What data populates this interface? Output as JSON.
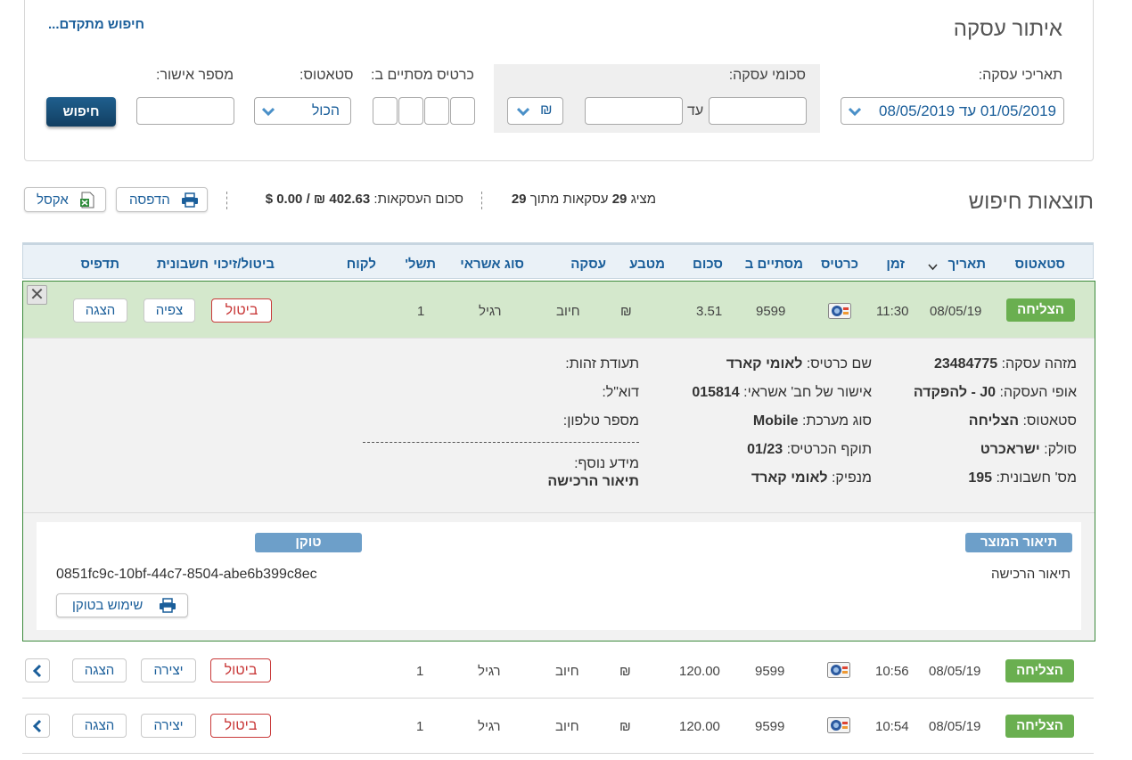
{
  "search": {
    "title": "איתור עסקה",
    "advanced_link": "חיפוש מתקדם...",
    "dates_label": "תאריכי עסקה:",
    "dates_value": "01/05/2019 עד 08/05/2019",
    "sums_label": "סכומי עסקה:",
    "sums_to": "עד",
    "currency_selected": "₪",
    "card_last_label": "כרטיס מסתיים ב:",
    "status_label": "סטאטוס:",
    "status_selected": "הכול",
    "approval_label": "מספר אישור:",
    "search_button": "חיפוש"
  },
  "results": {
    "title": "תוצאות חיפוש",
    "showing_prefix": "מציג",
    "showing_count": "29",
    "showing_mid": "עסקאות מתוך",
    "showing_total": "29",
    "sum_label": "סכום העסקאות:",
    "sum_ils": "402.63",
    "ils_sign": "₪",
    "slash": "/",
    "sum_usd": "0.00",
    "usd_sign": "$",
    "print_button": "הדפסה",
    "excel_button": "אקסל"
  },
  "columns": {
    "status": "סטאטוס",
    "date": "תאריך",
    "time": "זמן",
    "card": "כרטיס",
    "ends_with": "מסתיים ב",
    "amount": "סכום",
    "currency": "מטבע",
    "transaction": "עסקה",
    "credit_type": "סוג אשראי",
    "payments": "תשל'",
    "customer": "לקוח",
    "cancel_credit": "ביטול/זיכוי",
    "invoice": "חשבונית",
    "print": "תדפיס"
  },
  "expanded_row": {
    "status": "הצליחה",
    "date": "08/05/19",
    "time": "11:30",
    "ends_with": "9599",
    "amount": "3.51",
    "currency": "₪",
    "transaction": "חיוב",
    "credit_type": "רגיל",
    "payments": "1",
    "cancel_button": "ביטול",
    "invoice_button": "צפיה",
    "print_button": "הצגה",
    "close": "✕",
    "details": {
      "txn_id_label": "מזהה עסקה:",
      "txn_id": "23484775",
      "txn_mode_label": "אופי העסקה:",
      "txn_mode": "J0 - להפקדה",
      "status_label": "סטאטוס:",
      "status": "הצליחה",
      "acquirer_label": "סולק:",
      "acquirer": "ישראכרט",
      "invoice_no_label": "מס' חשבונית:",
      "invoice_no": "195",
      "card_name_label": "שם כרטיס:",
      "card_name": "לאומי קארד",
      "approval_label": "אישור של חב' אשראי:",
      "approval": "015814",
      "system_type_label": "סוג מערכת:",
      "system_type": "Mobile",
      "expiry_label": "תוקף הכרטיס:",
      "expiry": "01/23",
      "issuer_label": "מנפיק:",
      "issuer": "לאומי קארד",
      "id_label": "תעודת זהות:",
      "email_label": "דוא\"ל:",
      "phone_label": "מספר טלפון:",
      "extra_label": "מידע נוסף:",
      "extra_value": "תיאור הרכישה"
    },
    "product_tag": "תיאור המוצר",
    "product_desc": "תיאור הרכישה",
    "token_tag": "טוקן",
    "token_value": "0851fc9c-10bf-44c7-8504-abe6b399c8ec",
    "use_token_button": "שימוש בטוקן"
  },
  "rows": [
    {
      "status": "הצליחה",
      "date": "08/05/19",
      "time": "10:56",
      "ends_with": "9599",
      "amount": "120.00",
      "currency": "₪",
      "transaction": "חיוב",
      "credit_type": "רגיל",
      "payments": "1",
      "cancel_button": "ביטול",
      "invoice_button": "יצירה",
      "print_button": "הצגה"
    },
    {
      "status": "הצליחה",
      "date": "08/05/19",
      "time": "10:54",
      "ends_with": "9599",
      "amount": "120.00",
      "currency": "₪",
      "transaction": "חיוב",
      "credit_type": "רגיל",
      "payments": "1",
      "cancel_button": "ביטול",
      "invoice_button": "יצירה",
      "print_button": "הצגה"
    }
  ],
  "colors": {
    "accent": "#1a5e9a",
    "success": "#6aaf50",
    "danger": "#c93a3a",
    "tag": "#6d9fc9"
  },
  "icons": [
    "chevron-down-icon",
    "printer-icon",
    "excel-icon",
    "close-icon",
    "credit-card-icon",
    "chevron-left-icon",
    "sort-icon"
  ]
}
